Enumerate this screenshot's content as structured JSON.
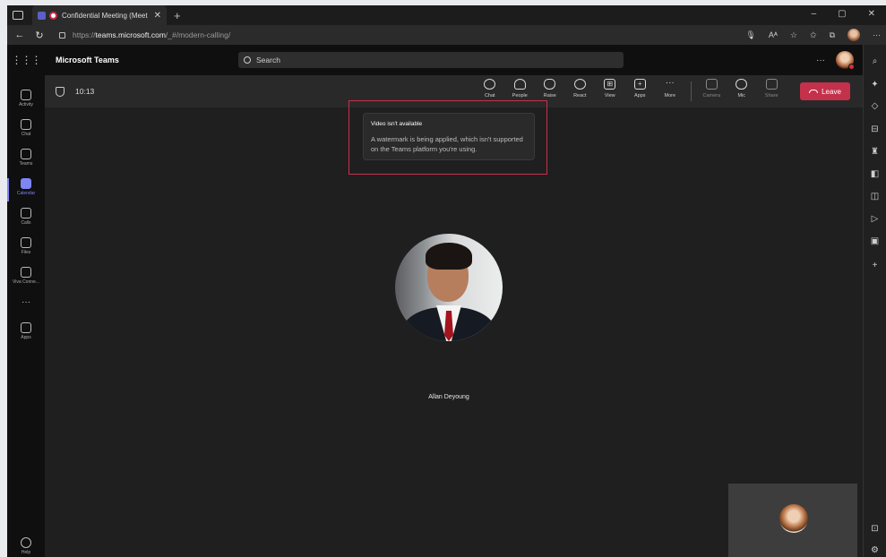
{
  "browser": {
    "tab_title": "Confidential Meeting (Meet",
    "url_prefix": "https://",
    "url_host": "teams.microsoft.com",
    "url_path": "/_#/modern-calling/",
    "win_min": "–",
    "win_restore": "▢",
    "win_close": "✕",
    "new_tab": "+",
    "more": "···"
  },
  "app": {
    "name": "Microsoft Teams",
    "search_placeholder": "Search",
    "more": "···"
  },
  "rail": {
    "items": [
      {
        "label": "Activity"
      },
      {
        "label": "Chat"
      },
      {
        "label": "Teams"
      },
      {
        "label": "Calendar"
      },
      {
        "label": "Calls"
      },
      {
        "label": "Files"
      },
      {
        "label": "Viva Conne..."
      },
      {
        "label": "Apps"
      },
      {
        "label": "Help"
      }
    ],
    "more": "···"
  },
  "meeting": {
    "timer": "10:13",
    "controls": {
      "chat": "Chat",
      "people": "People",
      "raise": "Raise",
      "react": "React",
      "view": "View",
      "apps": "Apps",
      "more": "More",
      "camera": "Camera",
      "mic": "Mic",
      "share": "Share"
    },
    "leave": "Leave"
  },
  "notice": {
    "title": "Video isn't available",
    "body": "A watermark is being applied, which isn't supported on the Teams platform you're using."
  },
  "participant": {
    "name": "Allan Deyoung"
  },
  "colors": {
    "accent": "#7f85f5",
    "leave": "#c4314b",
    "background": "#1f1f1f"
  }
}
